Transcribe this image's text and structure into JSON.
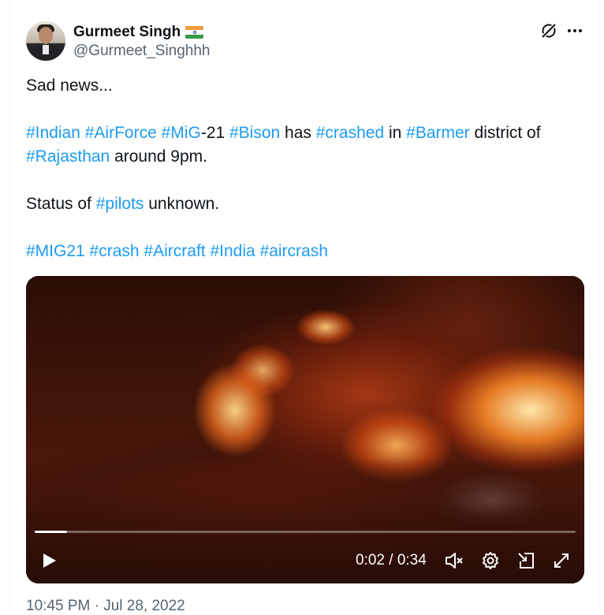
{
  "author": {
    "name": "Gurmeet Singh",
    "handle": "@Gurmeet_Singhhh",
    "flag_emoji": "india-flag"
  },
  "header_icons": [
    "grok-icon",
    "more-icon"
  ],
  "tweet": {
    "line1": "Sad news...",
    "para2": [
      {
        "t": "#Indian",
        "tag": true
      },
      {
        "t": " ",
        "tag": false
      },
      {
        "t": "#AirForce",
        "tag": true
      },
      {
        "t": " ",
        "tag": false
      },
      {
        "t": "#MiG",
        "tag": true
      },
      {
        "t": "-21 ",
        "tag": false
      },
      {
        "t": "#Bison",
        "tag": true
      },
      {
        "t": " has ",
        "tag": false
      },
      {
        "t": "#crashed",
        "tag": true
      },
      {
        "t": " in ",
        "tag": false
      },
      {
        "t": "#Barmer",
        "tag": true
      },
      {
        "t": " district of ",
        "tag": false
      },
      {
        "t": "#Rajasthan",
        "tag": true
      },
      {
        "t": " around 9pm.",
        "tag": false
      }
    ],
    "para3": [
      {
        "t": "Status of ",
        "tag": false
      },
      {
        "t": "#pilots",
        "tag": true
      },
      {
        "t": " unknown.",
        "tag": false
      }
    ],
    "para4": [
      {
        "t": "#MIG21",
        "tag": true
      },
      {
        "t": " ",
        "tag": false
      },
      {
        "t": "#crash",
        "tag": true
      },
      {
        "t": " ",
        "tag": false
      },
      {
        "t": "#Aircraft",
        "tag": true
      },
      {
        "t": " ",
        "tag": false
      },
      {
        "t": "#India",
        "tag": true
      },
      {
        "t": " ",
        "tag": false
      },
      {
        "t": "#aircrash",
        "tag": true
      }
    ]
  },
  "video": {
    "time_label": "0:02 / 0:34",
    "progress_fraction": 0.06,
    "controls": [
      "play-icon",
      "mute-icon",
      "settings-icon",
      "pip-icon",
      "fullscreen-icon"
    ]
  },
  "timestamp": "10:45 PM · Jul 28, 2022",
  "colors": {
    "link": "#1d9bf0",
    "text": "#0f1419",
    "secondary": "#536471"
  }
}
